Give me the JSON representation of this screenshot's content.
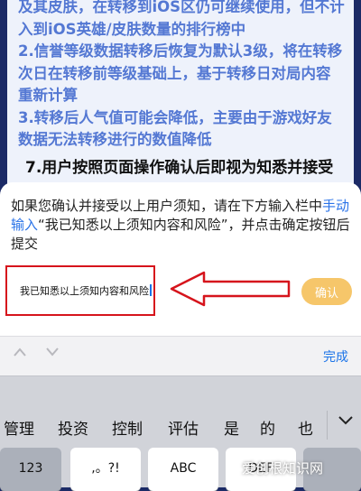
{
  "background": {
    "rules_text": "及其皮肤，在转移到iOS区仍可继续使用，但不计入到iOS英雄/皮肤数量的排行榜中\n2.信誉等级数据转移后恢复为默认3级，将在转移次日在转移前等级基础上，基于转移日对局内容重新计算\n3.转移后人气值可能会降低，主要由于游戏好友数据无法转移进行的数值降低",
    "para_text": "7.用户按照页面操作确认后即视为知悉并接受"
  },
  "notice": {
    "part1": "如果您确认并接受以上用户须知，请在下方输入栏中",
    "link": "手动输入",
    "part2": "“我已知悉以上须知内容和风险”，并点击确定按钮后提交"
  },
  "input": {
    "value": "我已知悉以上须知内容和风险"
  },
  "confirm_label": "确认",
  "keyboard": {
    "prev_icon": "chevron-up-icon",
    "next_icon": "chevron-down-icon",
    "done_label": "完成",
    "candidates": [
      "管理",
      "投资",
      "控制",
      "评估",
      "是",
      "的",
      "也"
    ],
    "keys": [
      "123",
      ",。?!",
      "ABC",
      "DEF"
    ]
  },
  "watermark": "爱创根知识网",
  "colors": {
    "accent": "#2a73e8",
    "confirm": "#f6c66a",
    "highlight": "#d6141c"
  }
}
